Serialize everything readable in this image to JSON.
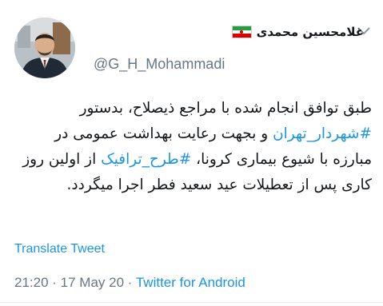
{
  "header": {
    "display_name": "غلامحسین محمدی",
    "handle": "@G_H_Mohammadi",
    "flag_icon": "iran-flag-icon",
    "menu_icon": "chevron-down-icon"
  },
  "tweet": {
    "text_parts": [
      {
        "text": "طبق توافق انجام شده با مراجع ذیصلاح، بدستور ",
        "hashtag": false
      },
      {
        "text": "#شهردار_تهران",
        "hashtag": true
      },
      {
        "text": " و بجهت رعایت بهداشت عمومی در مبارزه با شیوع بیماری کرونا، ",
        "hashtag": false
      },
      {
        "text": "#طرح_ترافیک",
        "hashtag": true
      },
      {
        "text": " از اولین روز کاری پس از تعطیلات عید سعید فطر اجرا میگردد.",
        "hashtag": false
      }
    ],
    "translate_label": "Translate Tweet"
  },
  "meta": {
    "time": "21:20",
    "separator1": " · ",
    "date": "17 May 20",
    "separator2": " · ",
    "source": "Twitter for Android"
  },
  "colors": {
    "link": "#1b95e0",
    "secondary_text": "#657786",
    "primary_text": "#14171a"
  }
}
